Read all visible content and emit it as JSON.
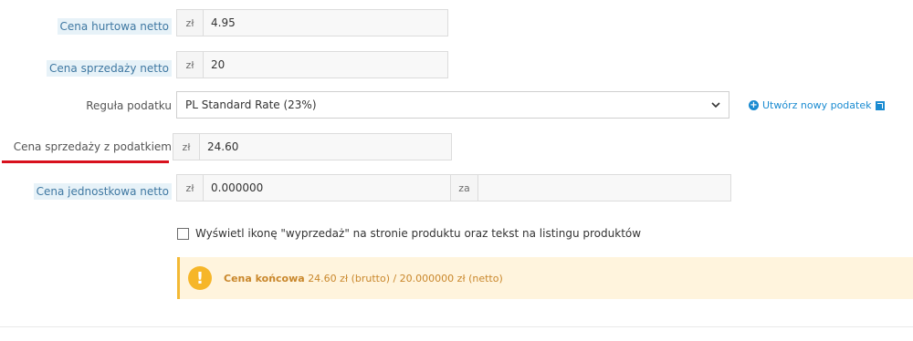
{
  "currency": "zł",
  "wholesale": {
    "label": "Cena hurtowa netto",
    "value": "4.95"
  },
  "retail_net": {
    "label": "Cena sprzedaży netto",
    "value": "20"
  },
  "tax_rule": {
    "label": "Reguła podatku",
    "selected": "PL Standard Rate (23%)",
    "create_link": "Utwórz nowy podatek"
  },
  "retail_tax": {
    "label": "Cena sprzedaży z podatkiem",
    "value": "24.60"
  },
  "unit_price": {
    "label": "Cena jednostkowa netto",
    "value": "0.000000",
    "per_label": "za",
    "per_value": ""
  },
  "on_sale": {
    "label": "Wyświetl ikonę \"wyprzedaż\" na stronie produktu oraz tekst na listingu produktów",
    "checked": false
  },
  "final_price": {
    "title": "Cena końcowa",
    "text": "24.60 zł (brutto) / 20.000000 zł (netto)"
  },
  "colors": {
    "highlight_label_bg": "#e7f2f8",
    "accent_blue": "#1a8bd1",
    "alert_bg": "#fff4dd",
    "alert_icon": "#f6b629",
    "underline_red": "#d8111d"
  }
}
